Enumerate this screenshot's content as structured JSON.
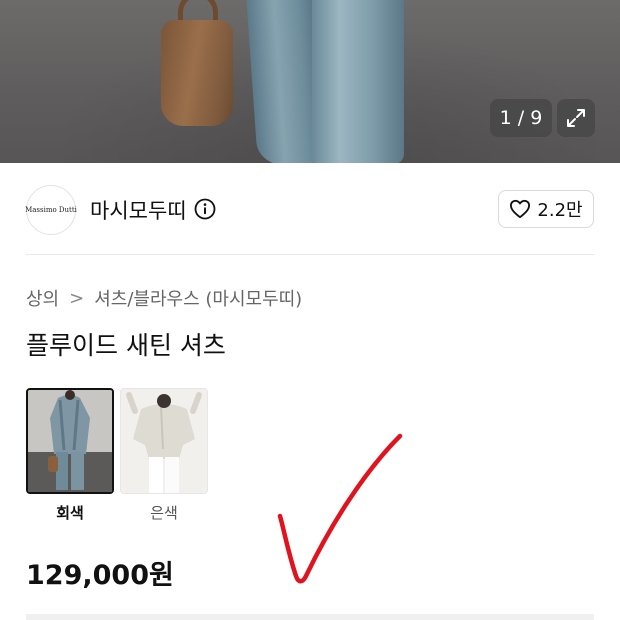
{
  "gallery": {
    "counter": "1 / 9",
    "expand_icon": "expand-icon"
  },
  "brand": {
    "logo_text": "Massimo Dutti",
    "name": "마시모두띠",
    "info_icon": "info-icon"
  },
  "like": {
    "icon": "heart-icon",
    "count": "2.2만"
  },
  "breadcrumb": {
    "level1": "상의",
    "separator": ">",
    "level2": "셔츠/블라우스 (마시모두띠)"
  },
  "product": {
    "title": "플루이드 새틴 셔츠",
    "price": "129,000원"
  },
  "colors": [
    {
      "label": "회색",
      "selected": true
    },
    {
      "label": "은색",
      "selected": false
    }
  ],
  "annotation": {
    "type": "checkmark",
    "color": "#e0141e"
  }
}
